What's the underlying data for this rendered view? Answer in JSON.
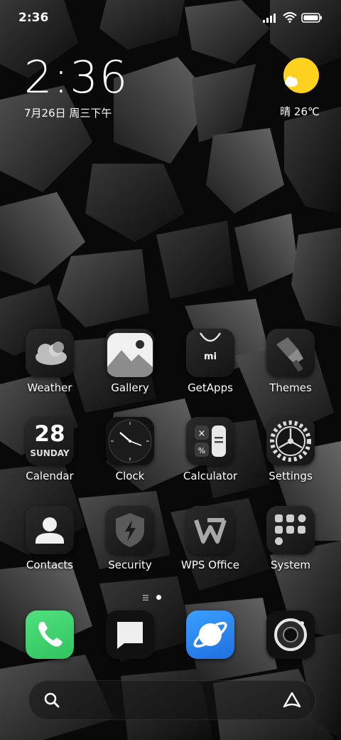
{
  "status_bar": {
    "time": "2:36",
    "signal_icon": "signal-icon",
    "wifi_icon": "wifi-icon",
    "battery_icon": "battery-icon"
  },
  "clock_widget": {
    "time": "2:36",
    "date": "7月26日 周三下午"
  },
  "weather_widget": {
    "icon": "sunny-cloud-icon",
    "text": "晴 26℃"
  },
  "apps": [
    {
      "label": "Weather",
      "icon": "weather-cloud-icon"
    },
    {
      "label": "Gallery",
      "icon": "gallery-icon"
    },
    {
      "label": "GetApps",
      "icon": "getapps-bag-icon"
    },
    {
      "label": "Themes",
      "icon": "themes-brush-icon"
    },
    {
      "label": "Calendar",
      "icon": "calendar-icon",
      "day_number": "28",
      "day_name": "SUNDAY"
    },
    {
      "label": "Clock",
      "icon": "clock-icon"
    },
    {
      "label": "Calculator",
      "icon": "calculator-icon"
    },
    {
      "label": "Settings",
      "icon": "settings-gear-icon"
    },
    {
      "label": "Contacts",
      "icon": "contacts-person-icon"
    },
    {
      "label": "Security",
      "icon": "security-shield-icon"
    },
    {
      "label": "WPS Office",
      "icon": "wps-office-icon"
    },
    {
      "label": "System",
      "icon": "system-folder-icon"
    }
  ],
  "page_indicator": {
    "pages": 2,
    "current": 2
  },
  "dock": [
    {
      "icon": "phone-icon"
    },
    {
      "icon": "messages-icon"
    },
    {
      "icon": "browser-icon"
    },
    {
      "icon": "camera-icon"
    }
  ],
  "search_bar": {
    "search_icon": "search-icon",
    "assistant_icon": "assistant-icon"
  },
  "colors": {
    "weather_sun": "#FFD21F",
    "phone_green": "#37D36B",
    "browser_blue": "#2A8CF5"
  }
}
